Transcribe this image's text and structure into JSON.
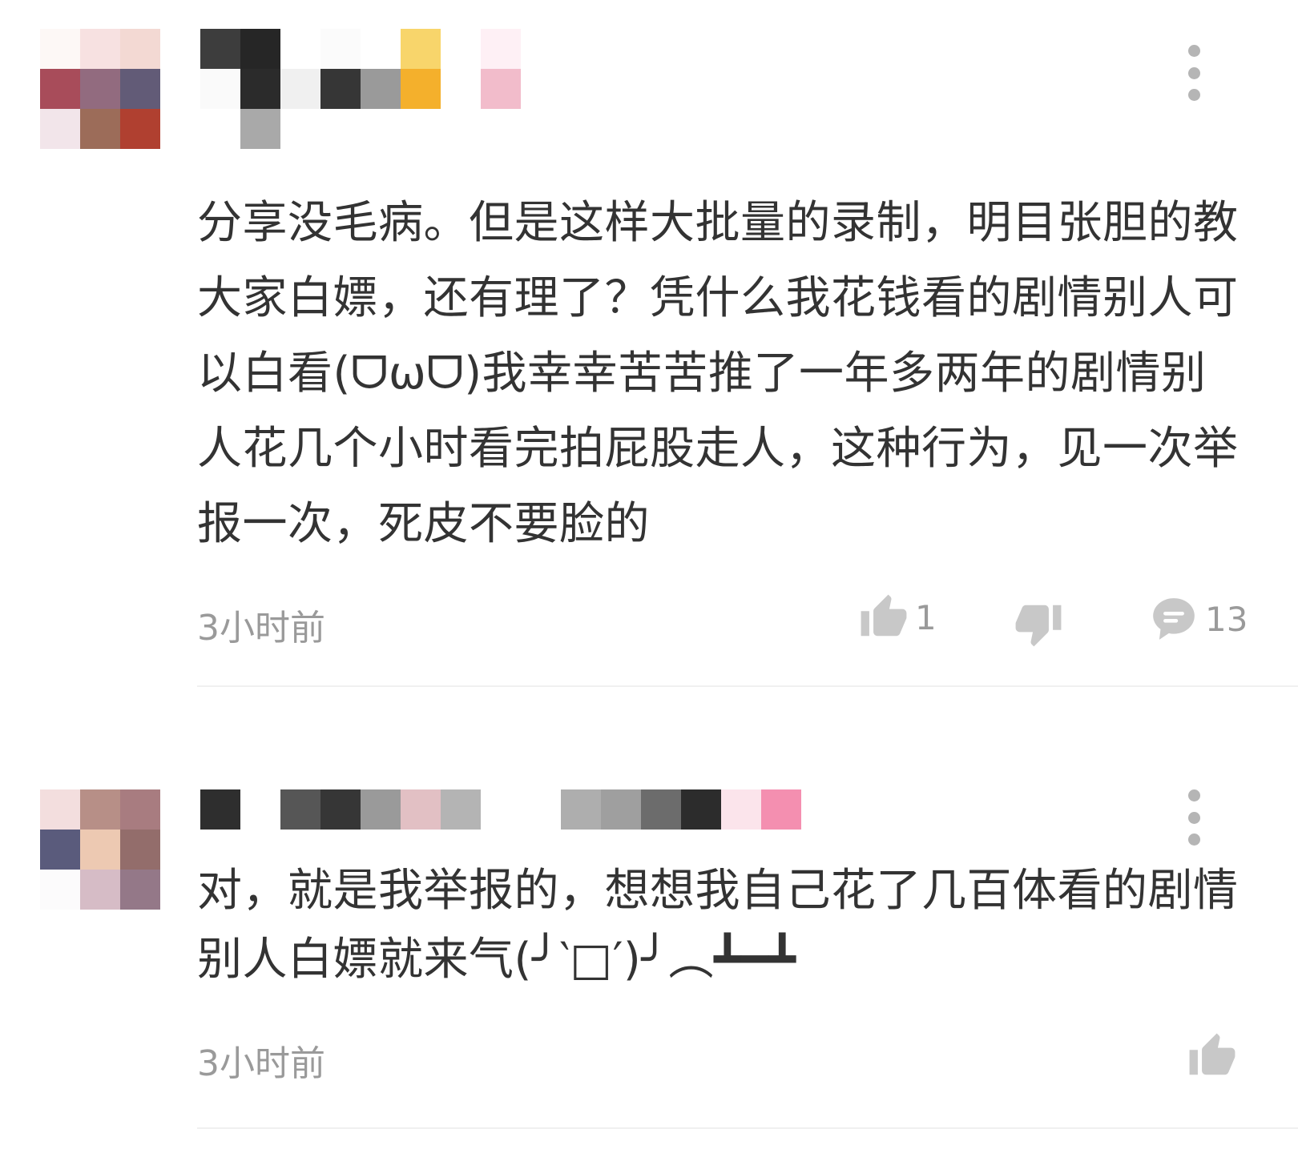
{
  "colors": {
    "text": "#333333",
    "meta": "#9a9a9a",
    "icon": "#c8c8c8",
    "divider": "#f0f0f0"
  },
  "comments": [
    {
      "avatar_pixels": [
        "#fdf8f6",
        "#f7e1e1",
        "#f3d9d3",
        "#a84c5a",
        "#926b7f",
        "#625b77",
        "#f2e5ea",
        "#9c6c59",
        "#b04030"
      ],
      "username_pixels": [
        "#3d3d3d",
        "#262626",
        "#ffffff",
        "#fbfbfb",
        "#ffffff",
        "#f8d56b",
        "#ffffff",
        "#fef0f5",
        "#fafafa",
        "#2b2b2b",
        "#f0f0f0",
        "#363636",
        "#9a9a9a",
        "#f4b02c",
        "#ffffff",
        "#f2bccb",
        "#ffffff",
        "#a9a9a9",
        "#ffffff",
        "#ffffff",
        "#ffffff",
        "#ffffff",
        "#ffffff",
        "#ffffff"
      ],
      "text": "分享没毛病。但是这样大批量的录制，明目张胆的教大家白嫖，还有理了？凭什么我花钱看的剧情别人可以白看(ᗜωᗜ)我幸幸苦苦推了一年多两年的剧情别人花几个小时看完拍屁股走人，这种行为，见一次举报一次，死皮不要脸的",
      "time": "3小时前",
      "likes": "1",
      "replies": "13",
      "icons": {
        "more": "more-vertical-icon",
        "like": "thumbs-up-icon",
        "dislike": "thumbs-down-icon",
        "reply": "comment-bubble-icon"
      }
    },
    {
      "avatar_pixels": [
        "#f3dede",
        "#b78f87",
        "#a87c80",
        "#5a5b7c",
        "#edc9b2",
        "#936d6b",
        "#fcfbfc",
        "#d6bcc6",
        "#947888"
      ],
      "username_pixels": [
        "#2e2e2e",
        "#ffffff",
        "#565656",
        "#363636",
        "#9a9a9a",
        "#e2c0c4",
        "#b4b4b4",
        "#ffffff",
        "#ffffff",
        "#aeaeae",
        "#9f9f9f",
        "#6c6c6c",
        "#2c2c2c",
        "#fbe4eb",
        "#f48fb0"
      ],
      "text": "对，就是我举报的，想想我自己花了几百体看的剧情别人白嫖就来气(╯‵□′)╯︵┻━┻",
      "time": "3小时前",
      "icons": {
        "more": "more-vertical-icon",
        "like": "thumbs-up-icon"
      }
    }
  ]
}
